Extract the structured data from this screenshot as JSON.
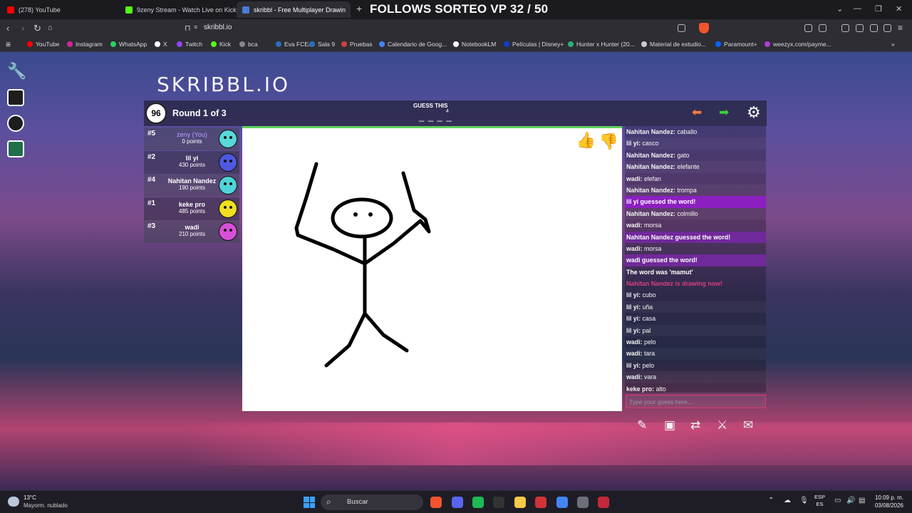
{
  "browser": {
    "tabs": [
      {
        "title": "(278) YouTube",
        "color": "#ff0000",
        "active": false
      },
      {
        "title": "9zeny Stream - Watch Live on Kick",
        "color": "#53fc18",
        "active": false
      },
      {
        "title": "skribbl - Free Multiplayer Drawin",
        "color": "#4a7bd8",
        "active": true
      }
    ],
    "new_tab": "+",
    "overlay_title": "FOLLOWS SORTEO VP 32 / 50",
    "url": "skribbl.io",
    "window_controls": [
      "⌄",
      "—",
      "❐",
      "✕"
    ],
    "bookmarks": [
      {
        "label": "YouTube",
        "color": "#ff0000"
      },
      {
        "label": "Instagram",
        "color": "#d6249f"
      },
      {
        "label": "WhatsApp",
        "color": "#25d366"
      },
      {
        "label": "X",
        "color": "#ffffff"
      },
      {
        "label": "Twitch",
        "color": "#9146ff"
      },
      {
        "label": "Kick",
        "color": "#53fc18"
      },
      {
        "label": "bca",
        "color": "#888888"
      },
      {
        "label": "Eva FCEA",
        "color": "#2a6ebd"
      },
      {
        "label": "Sala 9",
        "color": "#2a6ebd"
      },
      {
        "label": "Pruebas",
        "color": "#d04040"
      },
      {
        "label": "Calendario de Goog...",
        "color": "#4285f4"
      },
      {
        "label": "NotebookLM",
        "color": "#ffffff"
      },
      {
        "label": "Películas | Disney+",
        "color": "#113ccf"
      },
      {
        "label": "Hunter x Hunter (20...",
        "color": "#2ab07a"
      },
      {
        "label": "Material de estudio...",
        "color": "#cccccc"
      },
      {
        "label": "Paramount+",
        "color": "#0064ff"
      },
      {
        "label": "weezyx.com/payme...",
        "color": "#b23ad6"
      }
    ]
  },
  "game": {
    "logo": "SKRIBBL.IO",
    "timer": "96",
    "round": "Round 1 of 3",
    "guess_label": "GUESS THIS",
    "guess_count": "4",
    "guess_blanks": "_ _ _ _",
    "players": [
      {
        "rank": "#5",
        "name": "zeny (You)",
        "points": "0 points",
        "you": true,
        "avatar_color": "#58d8d8"
      },
      {
        "rank": "#2",
        "name": "lil yi",
        "points": "430 points",
        "you": false,
        "avatar_color": "#4c58e0"
      },
      {
        "rank": "#4",
        "name": "Nahitan Nandez",
        "points": "190 points",
        "you": false,
        "avatar_color": "#4fd3d8"
      },
      {
        "rank": "#1",
        "name": "keke pro",
        "points": "485 points",
        "you": false,
        "avatar_color": "#f0e020"
      },
      {
        "rank": "#3",
        "name": "wadi",
        "points": "210 points",
        "you": false,
        "avatar_color": "#d84fd8"
      }
    ],
    "chat": [
      {
        "user": "Nahitan Nandez:",
        "text": "caballo",
        "type": "msg"
      },
      {
        "user": "lil yi:",
        "text": "casco",
        "type": "msg"
      },
      {
        "user": "Nahitan Nandez:",
        "text": "gato",
        "type": "msg"
      },
      {
        "user": "Nahitan Nandez:",
        "text": "elefante",
        "type": "msg"
      },
      {
        "user": "wadi:",
        "text": "elefan",
        "type": "msg"
      },
      {
        "user": "Nahitan Nandez:",
        "text": "trompa",
        "type": "msg"
      },
      {
        "user": "",
        "text": "lil yi guessed the word!",
        "type": "guessed"
      },
      {
        "user": "Nahitan Nandez:",
        "text": "colmillo",
        "type": "msg"
      },
      {
        "user": "wadi:",
        "text": "morsa",
        "type": "msg"
      },
      {
        "user": "",
        "text": "Nahitan Nandez guessed the word!",
        "type": "guessed2"
      },
      {
        "user": "wadi:",
        "text": "morsa",
        "type": "msg"
      },
      {
        "user": "",
        "text": "wadi guessed the word!",
        "type": "guessed2"
      },
      {
        "user": "",
        "text": "The word was 'mamut'",
        "type": "word"
      },
      {
        "user": "",
        "text": "Nahitan Nandez is drawing now!",
        "type": "drawing"
      },
      {
        "user": "lil yi:",
        "text": "cubo",
        "type": "msg"
      },
      {
        "user": "lil yi:",
        "text": "uña",
        "type": "msg"
      },
      {
        "user": "lil yi:",
        "text": "casa",
        "type": "msg"
      },
      {
        "user": "lil yi:",
        "text": "pal",
        "type": "msg"
      },
      {
        "user": "wadi:",
        "text": "pelo",
        "type": "msg"
      },
      {
        "user": "wadi:",
        "text": "tara",
        "type": "msg"
      },
      {
        "user": "lil yi:",
        "text": "pelo",
        "type": "msg"
      },
      {
        "user": "wadi:",
        "text": "vara",
        "type": "msg"
      },
      {
        "user": "keke pro:",
        "text": "alto",
        "type": "msg"
      }
    ],
    "chat_placeholder": "Type your guess here...",
    "arrow_left": "⬅",
    "arrow_right": "➡",
    "gear": "⚙"
  },
  "taskbar": {
    "weather_temp": "13°C",
    "weather_desc": "Mayorm. nublado",
    "search": "Buscar",
    "lang_top": "ESP",
    "lang_bottom": "ES",
    "time": "10:09 p. m.",
    "date": "03/08/2026",
    "apps": [
      {
        "name": "brave-app-icon",
        "color": "#f2542d"
      },
      {
        "name": "discord-app-icon",
        "color": "#5865f2"
      },
      {
        "name": "spotify-app-icon",
        "color": "#1db954"
      },
      {
        "name": "epic-games-app-icon",
        "color": "#333333"
      },
      {
        "name": "file-explorer-app-icon",
        "color": "#f7c948"
      },
      {
        "name": "app-red-icon",
        "color": "#d13438"
      },
      {
        "name": "chrome-app-icon",
        "color": "#4285f4"
      },
      {
        "name": "steam-app-icon",
        "color": "#6a6f7a"
      },
      {
        "name": "app-red-2-icon",
        "color": "#c3283b"
      }
    ]
  }
}
